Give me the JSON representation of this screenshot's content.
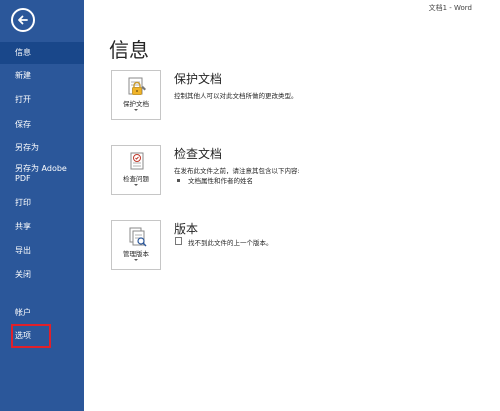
{
  "window": {
    "title": "文档1 - Word"
  },
  "sidebar": {
    "items": [
      {
        "label": "信息"
      },
      {
        "label": "新建"
      },
      {
        "label": "打开"
      },
      {
        "label": "保存"
      },
      {
        "label": "另存为"
      },
      {
        "label": "另存为 Adobe"
      },
      {
        "label": "PDF"
      },
      {
        "label": "打印"
      },
      {
        "label": "共享"
      },
      {
        "label": "导出"
      },
      {
        "label": "关闭"
      },
      {
        "label": "帐户"
      },
      {
        "label": "选项"
      }
    ],
    "background": "#2b579a",
    "active_background": "#19478a",
    "highlight_color": "#e0202a"
  },
  "main": {
    "title": "信息",
    "sections": [
      {
        "button_label": "保护文档",
        "title": "保护文档",
        "description": "控制其他人可以对此文档所做的更改类型。",
        "icon": "lock-icon"
      },
      {
        "button_label": "检查问题",
        "title": "检查文档",
        "description": "在发布此文件之前，请注意其包含以下内容:",
        "bullets": [
          "文档属性和作者的姓名"
        ],
        "icon": "inspect-icon"
      },
      {
        "button_label": "管理版本",
        "title": "版本",
        "description": "找不到此文件的上一个版本。",
        "icon": "versions-icon"
      }
    ]
  }
}
